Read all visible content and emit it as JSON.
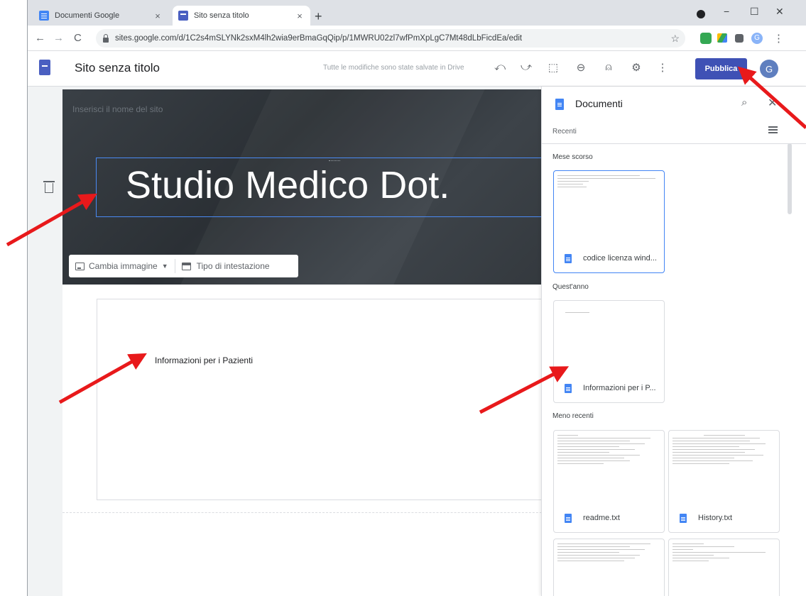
{
  "tabs": [
    {
      "title": "Documenti Google",
      "close": "×"
    },
    {
      "title": "Sito senza titolo",
      "close": "×"
    }
  ],
  "new_tab": "+",
  "window_controls": {
    "minimize": "−",
    "maximize": "☐",
    "close": "✕"
  },
  "nav": {
    "back": "←",
    "forward": "→",
    "reload": "C"
  },
  "url": "sites.google.com/d/1C2s4mSLYNk2sxM4lh2wia9erBmaGqQip/p/1MWRU02zl7wfPmXpLgC7Mt48dLbFicdEa/edit",
  "star": "☆",
  "extensions_avatar": "G",
  "app": {
    "site_title": "Sito senza titolo",
    "saved_message": "Tutte le modifiche sono state salvate in Drive",
    "publish_label": "Pubblica",
    "avatar_letter": "G",
    "icons": {
      "undo": "⤺",
      "redo": "⤻",
      "preview": "⬚",
      "link": "⊖",
      "share": "⍝",
      "settings": "⚙",
      "more": "⋮"
    }
  },
  "editor": {
    "site_name_placeholder": "Inserisci il nome del sito",
    "heading": "Studio Medico Dot.",
    "change_image": "Cambia immagine",
    "header_type": "Tipo di intestazione",
    "content_text": "Informazioni per i Pazienti"
  },
  "panel": {
    "title": "Documenti",
    "search": "⌕",
    "close": "✕",
    "sort_label": "Recenti",
    "sections": [
      {
        "label": "Mese scorso",
        "docs": [
          "codice licenza wind..."
        ]
      },
      {
        "label": "Quest'anno",
        "docs": [
          "Informazioni per i P..."
        ]
      },
      {
        "label": "Meno recenti",
        "docs": [
          "readme.txt",
          "History.txt"
        ]
      }
    ]
  },
  "colors": {
    "publish": "#3f51b5",
    "accent": "#4285f4",
    "arrow": "#e8191b"
  }
}
